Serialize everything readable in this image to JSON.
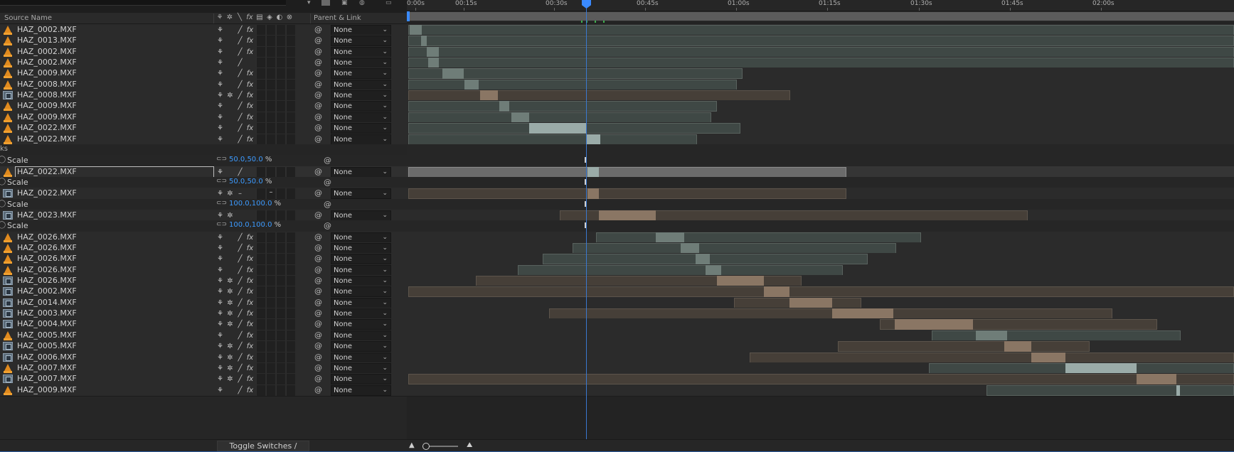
{
  "header": {
    "col_source_name": "Source Name",
    "col_parent_link": "Parent & Link",
    "switch_icons": [
      "shy-icon",
      "collapse-icon",
      "quality-icon",
      "fx",
      "frame-blend-icon",
      "motion-blur-icon",
      "adjustment-icon",
      "3d-icon"
    ]
  },
  "ruler": {
    "ticks": [
      "0:00s",
      "00:15s",
      "00:30s",
      "00:45s",
      "01:00s",
      "01:15s",
      "01:30s",
      "01:45s",
      "02:00s"
    ]
  },
  "layers": [
    {
      "name": "HAZ_0002.MXF",
      "kind": "layer",
      "icon": "cone",
      "fx": true,
      "sun": false,
      "parent": "None"
    },
    {
      "name": "HAZ_0013.MXF",
      "kind": "layer",
      "icon": "cone",
      "fx": true,
      "sun": false,
      "parent": "None"
    },
    {
      "name": "HAZ_0002.MXF",
      "kind": "layer",
      "icon": "cone",
      "fx": true,
      "sun": false,
      "parent": "None"
    },
    {
      "name": "HAZ_0002.MXF",
      "kind": "layer",
      "icon": "cone",
      "fx": false,
      "sun": false,
      "parent": "None"
    },
    {
      "name": "HAZ_0009.MXF",
      "kind": "layer",
      "icon": "cone",
      "fx": true,
      "sun": false,
      "parent": "None"
    },
    {
      "name": "HAZ_0008.MXF",
      "kind": "layer",
      "icon": "cone",
      "fx": true,
      "sun": false,
      "parent": "None"
    },
    {
      "name": "HAZ_0008.MXF",
      "kind": "layer",
      "icon": "film",
      "fx": true,
      "sun": true,
      "parent": "None"
    },
    {
      "name": "HAZ_0009.MXF",
      "kind": "layer",
      "icon": "cone",
      "fx": true,
      "sun": false,
      "parent": "None"
    },
    {
      "name": "HAZ_0009.MXF",
      "kind": "layer",
      "icon": "cone",
      "fx": true,
      "sun": false,
      "parent": "None"
    },
    {
      "name": "HAZ_0022.MXF",
      "kind": "layer",
      "icon": "cone",
      "fx": true,
      "sun": false,
      "parent": "None"
    },
    {
      "name": "HAZ_0022.MXF",
      "kind": "layer",
      "icon": "cone",
      "fx": true,
      "sun": false,
      "parent": "None"
    },
    {
      "name": "ks",
      "kind": "group"
    },
    {
      "name": "Scale",
      "kind": "prop",
      "value": "50.0,50.0",
      "unit": "%"
    },
    {
      "name": "HAZ_0022.MXF",
      "kind": "sel",
      "icon": "cone",
      "fx": false,
      "sun": false,
      "parent": "None"
    },
    {
      "name": "Scale",
      "kind": "prop",
      "value": "50.0,50.0",
      "unit": "%"
    },
    {
      "name": "HAZ_0022.MXF",
      "kind": "layer",
      "icon": "film",
      "fx": false,
      "sun": true,
      "parent": "None",
      "dash": true
    },
    {
      "name": "Scale",
      "kind": "prop",
      "value": "100.0,100.0",
      "unit": "%"
    },
    {
      "name": "HAZ_0023.MXF",
      "kind": "layer",
      "icon": "film",
      "fx": false,
      "sun": true,
      "parent": "None",
      "nopencil": true
    },
    {
      "name": "Scale",
      "kind": "prop",
      "value": "100.0,100.0",
      "unit": "%"
    },
    {
      "name": "HAZ_0026.MXF",
      "kind": "layer",
      "icon": "cone",
      "fx": true,
      "sun": false,
      "parent": "None"
    },
    {
      "name": "HAZ_0026.MXF",
      "kind": "layer",
      "icon": "cone",
      "fx": true,
      "sun": false,
      "parent": "None"
    },
    {
      "name": "HAZ_0026.MXF",
      "kind": "layer",
      "icon": "cone",
      "fx": true,
      "sun": false,
      "parent": "None"
    },
    {
      "name": "HAZ_0026.MXF",
      "kind": "layer",
      "icon": "cone",
      "fx": true,
      "sun": false,
      "parent": "None"
    },
    {
      "name": "HAZ_0026.MXF",
      "kind": "layer",
      "icon": "film",
      "fx": true,
      "sun": true,
      "parent": "None"
    },
    {
      "name": "HAZ_0002.MXF",
      "kind": "layer",
      "icon": "film",
      "fx": true,
      "sun": true,
      "parent": "None"
    },
    {
      "name": "HAZ_0014.MXF",
      "kind": "layer",
      "icon": "film",
      "fx": true,
      "sun": true,
      "parent": "None"
    },
    {
      "name": "HAZ_0003.MXF",
      "kind": "layer",
      "icon": "film",
      "fx": true,
      "sun": true,
      "parent": "None"
    },
    {
      "name": "HAZ_0004.MXF",
      "kind": "layer",
      "icon": "film",
      "fx": true,
      "sun": true,
      "parent": "None"
    },
    {
      "name": "HAZ_0005.MXF",
      "kind": "layer",
      "icon": "cone",
      "fx": true,
      "sun": false,
      "parent": "None"
    },
    {
      "name": "HAZ_0005.MXF",
      "kind": "layer",
      "icon": "film",
      "fx": true,
      "sun": true,
      "parent": "None"
    },
    {
      "name": "HAZ_0006.MXF",
      "kind": "layer",
      "icon": "film",
      "fx": true,
      "sun": true,
      "parent": "None"
    },
    {
      "name": "HAZ_0007.MXF",
      "kind": "layer",
      "icon": "cone",
      "fx": true,
      "sun": true,
      "parent": "None"
    },
    {
      "name": "HAZ_0007.MXF",
      "kind": "layer",
      "icon": "film",
      "fx": true,
      "sun": true,
      "parent": "None"
    },
    {
      "name": "HAZ_0009.MXF",
      "kind": "layer",
      "icon": "cone",
      "fx": true,
      "sun": false,
      "parent": "None"
    }
  ],
  "footer": {
    "toggle_label": "Toggle Switches / Modes"
  },
  "colors": {
    "accent": "#3a8aff",
    "clip_green": "#3f4845",
    "clip_brown": "#463f38",
    "value_blue": "#3d9bff"
  }
}
